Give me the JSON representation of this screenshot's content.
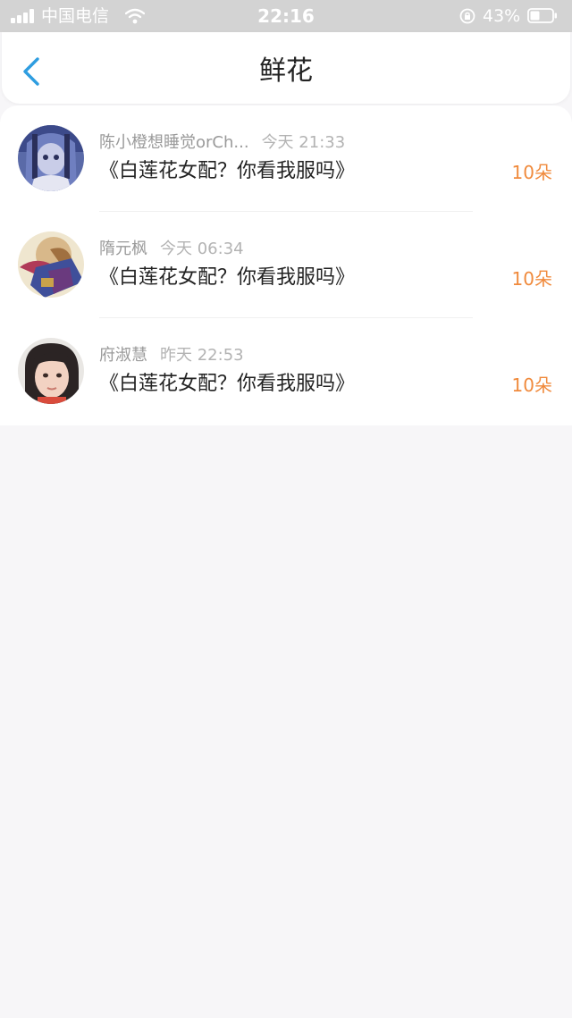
{
  "status_bar": {
    "carrier": "中国电信",
    "time": "22:16",
    "battery": "43%"
  },
  "header": {
    "title": "鲜花"
  },
  "colors": {
    "accent": "#2e9de0",
    "count": "#f08a3c"
  },
  "items": [
    {
      "name": "陈小橙想睡觉orCh...",
      "time": "今天 21:33",
      "book": "《白莲花女配？你看我服吗》",
      "count": "10朵"
    },
    {
      "name": "隋元枫",
      "time": "今天 06:34",
      "book": "《白莲花女配？你看我服吗》",
      "count": "10朵"
    },
    {
      "name": "府淑慧",
      "time": "昨天 22:53",
      "book": "《白莲花女配？你看我服吗》",
      "count": "10朵"
    }
  ]
}
